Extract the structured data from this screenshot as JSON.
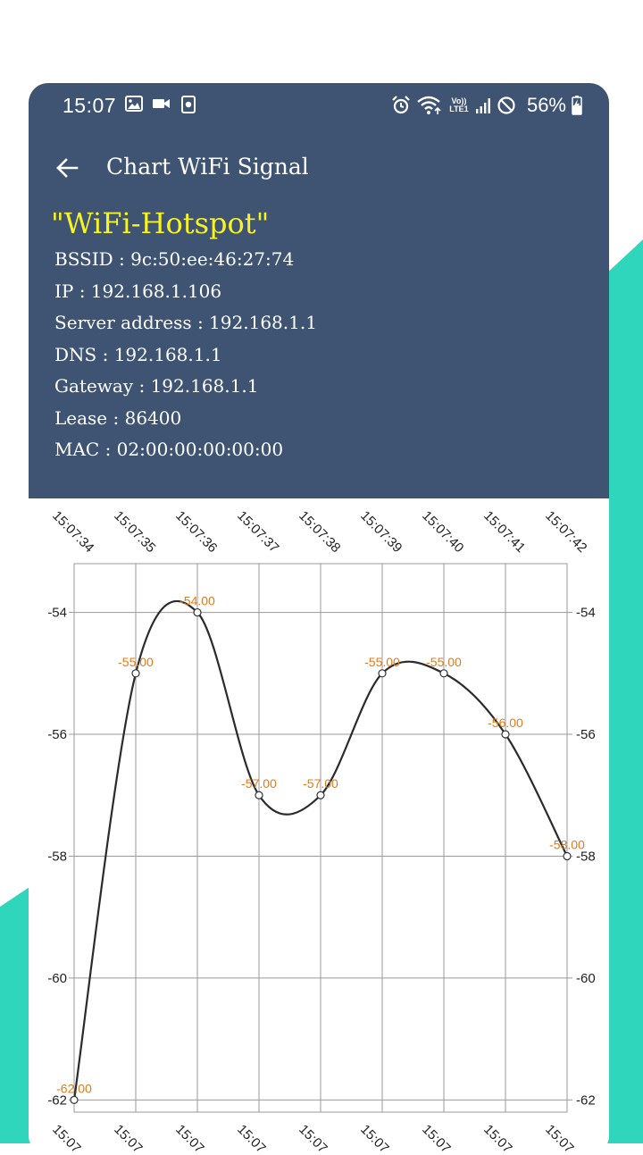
{
  "status_bar": {
    "time": "15:07",
    "left_icons": [
      "image-icon",
      "video-camera-icon",
      "screen-record-icon"
    ],
    "right_icons": [
      "alarm-icon",
      "wifi-icon",
      "volte-lte-icon",
      "signal-bars-icon",
      "do-not-disturb-icon"
    ],
    "volte_label": "Vo)) LTE1",
    "battery_percent": "56%"
  },
  "toolbar": {
    "back_icon": "arrow-left-icon",
    "title": "Chart WiFi Signal"
  },
  "network": {
    "ssid": "\"WiFi-Hotspot\"",
    "bssid": "BSSID : 9c:50:ee:46:27:74",
    "ip": "IP : 192.168.1.106",
    "server_address": "Server address : 192.168.1.1",
    "dns": "DNS : 192.168.1.1",
    "gateway": "Gateway : 192.168.1.1",
    "lease": "Lease : 86400",
    "mac": "MAC : 02:00:00:00:00:00"
  },
  "colors": {
    "header_bg": "#3f5473",
    "ssid": "#f8f322",
    "accent_teal": "#2fd6bb",
    "value_label": "#e07b1a",
    "line": "#2b2b2b",
    "grid": "#9a9a9a"
  },
  "chart_data": {
    "type": "line",
    "x": [
      "15:07:34",
      "15:07:35",
      "15:07:36",
      "15:07:37",
      "15:07:38",
      "15:07:39",
      "15:07:40",
      "15:07:41",
      "15:07:42"
    ],
    "bottom_tick_labels": [
      "15:07",
      "15:07",
      "15:07",
      "15:07",
      "15:07",
      "15:07",
      "15:07",
      "15:07",
      "15:07"
    ],
    "series": [
      {
        "values": [
          -62,
          -55,
          -54,
          -57,
          -57,
          -55,
          -55,
          -56,
          -58
        ],
        "labels": [
          "-62.00",
          "-55.00",
          "-54.00",
          "-57.00",
          "-57.00",
          "-55.00",
          "-55.00",
          "-56.00",
          "-58.00"
        ]
      }
    ],
    "ylim": [
      -62.2,
      -53.2
    ],
    "yticks": [
      -62,
      -60,
      -58,
      -56,
      -54
    ],
    "ytick_labels": [
      "-62",
      "-60",
      "-58",
      "-56",
      "-54"
    ],
    "grid": true,
    "y_axis_both_sides": true,
    "title": "",
    "xlabel": "",
    "ylabel": ""
  }
}
